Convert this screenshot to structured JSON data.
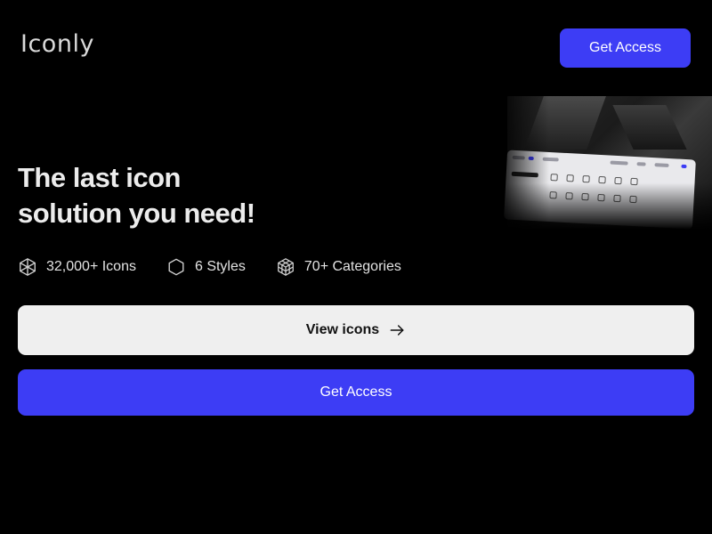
{
  "header": {
    "logo_text": "Iconly",
    "cta_label": "Get Access"
  },
  "hero": {
    "title_line1": "The last icon",
    "title_line2": "solution you need!"
  },
  "features": [
    {
      "icon": "cube-cluster-icon",
      "label": "32,000+ Icons"
    },
    {
      "icon": "hexagon-icon",
      "label": "6 Styles"
    },
    {
      "icon": "cube-grid-icon",
      "label": "70+ Categories"
    }
  ],
  "actions": {
    "view_icons_label": "View icons",
    "view_icons_icon": "arrow-right-icon",
    "get_access_label": "Get Access"
  },
  "colors": {
    "background": "#000000",
    "accent": "#3d3df5",
    "secondary_button": "#efefef",
    "text_primary": "#ececec"
  }
}
